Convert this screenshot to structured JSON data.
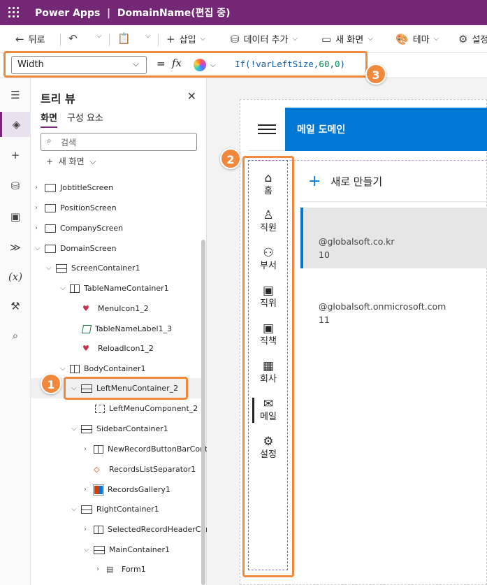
{
  "titlebar": {
    "app": "Power Apps",
    "separator": "|",
    "doc": "DomainName(편집 중)"
  },
  "cmdbar": {
    "back": "뒤로",
    "insert": "삽입",
    "add_data": "데이터 추가",
    "new_screen": "새 화면",
    "theme": "테마",
    "settings": "설정"
  },
  "formula": {
    "property": "Width",
    "equals": "=",
    "fx": "fx",
    "text_if": "If(",
    "text_var": "!varLeftSize,",
    "text_n1": "60",
    "text_comma": ",",
    "text_n2": "0",
    "text_close": ")"
  },
  "tree": {
    "title": "트리 뷰",
    "tabs": [
      "화면",
      "구성 요소"
    ],
    "search_placeholder": "검색",
    "new_screen": "새 화면",
    "nodes": [
      "JobtitleScreen",
      "PositionScreen",
      "CompanyScreen",
      "DomainScreen",
      "ScreenContainer1",
      "TableNameContainer1",
      "MenuIcon1_2",
      "TableNameLabel1_3",
      "ReloadIcon1_2",
      "BodyContainer1",
      "LeftMenuContainer_2",
      "LeftMenuComponent_2",
      "SidebarContainer1",
      "NewRecordButtonBarConta",
      "RecordsListSeparator1",
      "RecordsGallery1",
      "RightContainer1",
      "SelectedRecordHeaderCon",
      "MainContainer1",
      "Form1"
    ]
  },
  "app": {
    "title": "메일 도메인",
    "menu": [
      "홈",
      "직원",
      "부서",
      "직위",
      "직책",
      "회사",
      "메일",
      "설정"
    ],
    "new_record": "새로 만들기",
    "records": [
      {
        "domain": "@globalsoft.co.kr",
        "num": "10"
      },
      {
        "domain": "@globalsoft.onmicrosoft.com",
        "num": "11"
      }
    ]
  },
  "badges": [
    "1",
    "2",
    "3"
  ],
  "colors": {
    "brand": "#742774",
    "accent": "#0078d4",
    "highlight": "#f0883e"
  }
}
